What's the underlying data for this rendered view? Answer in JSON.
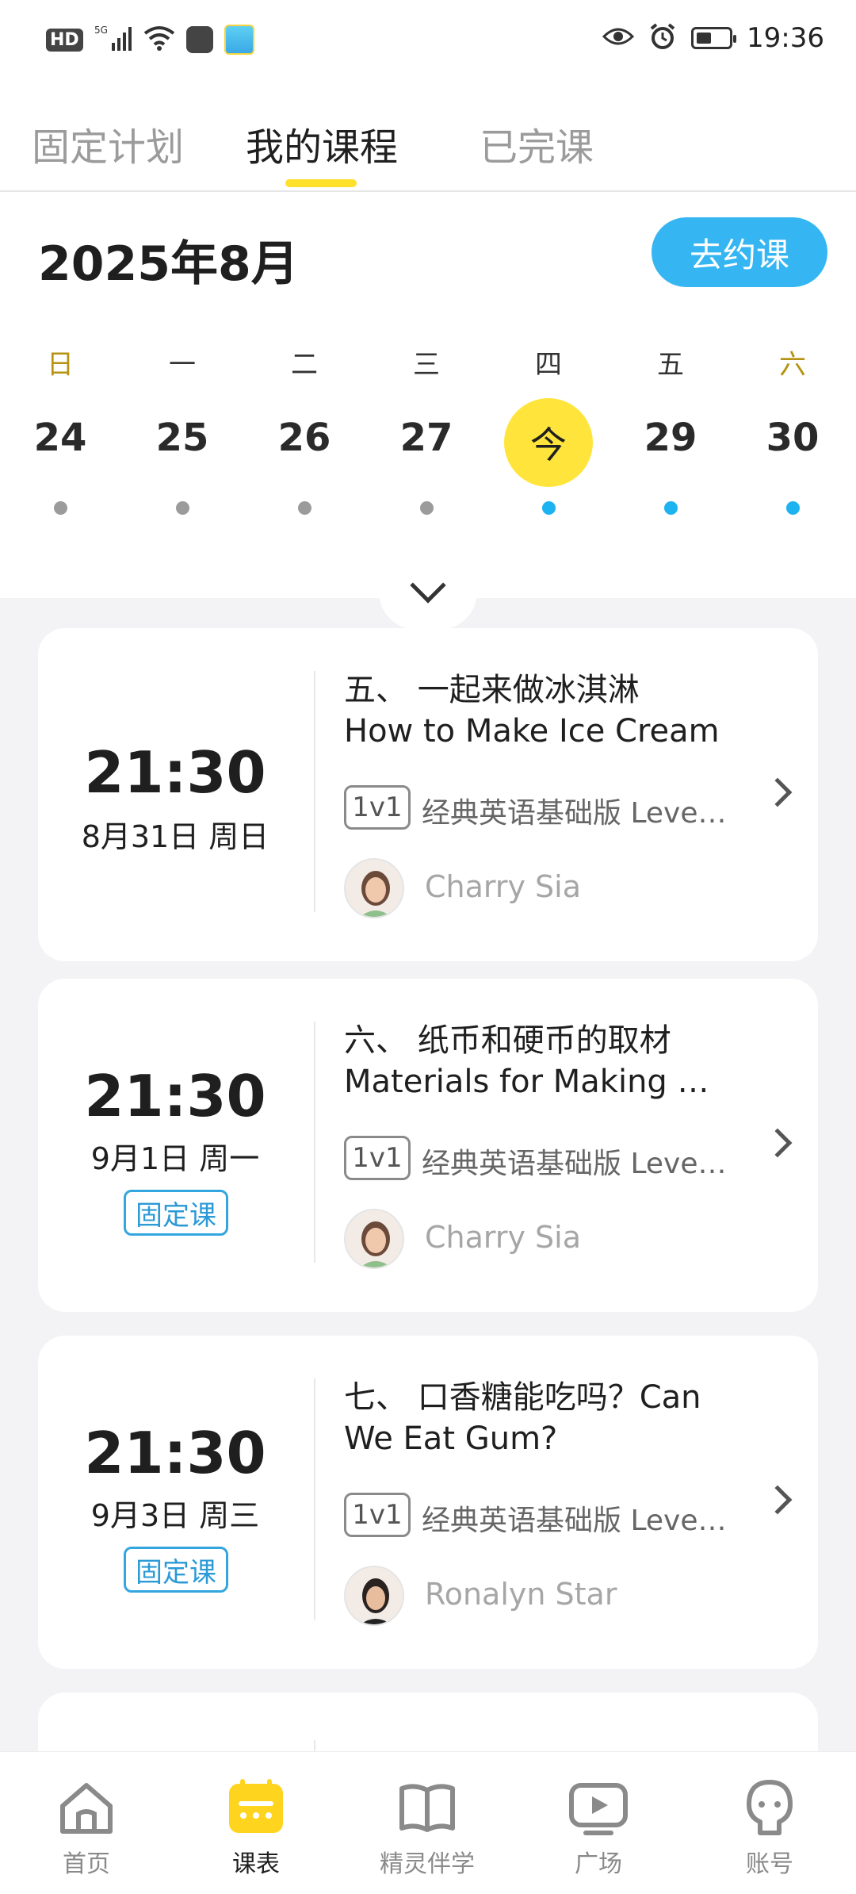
{
  "status_bar": {
    "left_text": "HD",
    "network": "5G",
    "time": "19:36"
  },
  "top_tabs": [
    {
      "label": "固定计划",
      "active": false
    },
    {
      "label": "我的课程",
      "active": true
    },
    {
      "label": "已完课",
      "active": false
    }
  ],
  "calendar": {
    "month_title": "2025年8月",
    "book_button": "去约课",
    "weekdays": [
      "日",
      "一",
      "二",
      "三",
      "四",
      "五",
      "六"
    ],
    "dates": [
      "24",
      "25",
      "26",
      "27",
      "今",
      "29",
      "30"
    ],
    "today_index": 4,
    "dots": [
      "gray",
      "gray",
      "gray",
      "gray",
      "blue",
      "blue",
      "blue"
    ]
  },
  "courses": [
    {
      "time": "21:30",
      "date": "8月31日 周日",
      "tag": "",
      "title_cn": "五、 一起来做冰淇淋",
      "title_en": "How to Make Ice Cream",
      "badge": "1v1",
      "course_name": "经典英语基础版 Leve…",
      "teacher": "Charry Sia"
    },
    {
      "time": "21:30",
      "date": "9月1日 周一",
      "tag": "固定课",
      "title_cn": "六、 纸币和硬币的取材",
      "title_en": "Materials for Making …",
      "badge": "1v1",
      "course_name": "经典英语基础版 Leve…",
      "teacher": "Charry Sia"
    },
    {
      "time": "21:30",
      "date": "9月3日 周三",
      "tag": "固定课",
      "title_cn": "七、 口香糖能吃吗？Can",
      "title_en": "We Eat Gum?",
      "badge": "1v1",
      "course_name": "经典英语基础版 Leve…",
      "teacher": "Ronalyn Star"
    }
  ],
  "bottom_nav": [
    {
      "label": "首页",
      "icon": "home-icon",
      "active": false
    },
    {
      "label": "课表",
      "icon": "calendar-icon",
      "active": true
    },
    {
      "label": "精灵伴学",
      "icon": "book-icon",
      "active": false
    },
    {
      "label": "广场",
      "icon": "video-icon",
      "active": false
    },
    {
      "label": "账号",
      "icon": "account-icon",
      "active": false
    }
  ],
  "colors": {
    "accent_yellow": "#ffe53b",
    "accent_blue": "#35b6f2"
  }
}
